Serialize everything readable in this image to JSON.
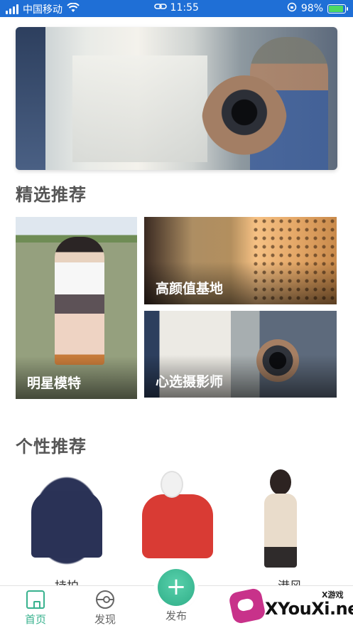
{
  "status_bar": {
    "carrier": "中国移动",
    "time": "11:55",
    "battery_percent": "98%",
    "battery_level": 0.98,
    "background_color": "#1f6fd6"
  },
  "banner": {
    "image": "photographer-with-camera",
    "active_slide": 1
  },
  "featured": {
    "title": "精选推荐",
    "tiles": [
      {
        "label": "明星模特",
        "image": "girl-school-uniform"
      },
      {
        "label": "高颜值基地",
        "image": "studio-base-interior"
      },
      {
        "label": "心选摄影师",
        "image": "photographer-with-camera"
      }
    ]
  },
  "personal": {
    "title": "个性推荐",
    "products": [
      {
        "label": "持拍",
        "image": "navy-sweater"
      },
      {
        "label": "",
        "image": "red-sweatshirt-model"
      },
      {
        "label": "港风",
        "image": "beige-cardigan-model"
      }
    ]
  },
  "tabbar": {
    "items": [
      {
        "label": "首页",
        "icon": "home-icon",
        "active": true
      },
      {
        "label": "发现",
        "icon": "discover-icon",
        "active": false
      },
      {
        "label": "发布",
        "icon": "plus-icon",
        "active": false
      },
      {
        "label": "",
        "icon": "message-icon",
        "active": false
      }
    ],
    "publish_symbol": "+",
    "accent_color": "#38b28e"
  },
  "watermark": {
    "small_text": "X游戏",
    "site": "XYouXi.net"
  }
}
